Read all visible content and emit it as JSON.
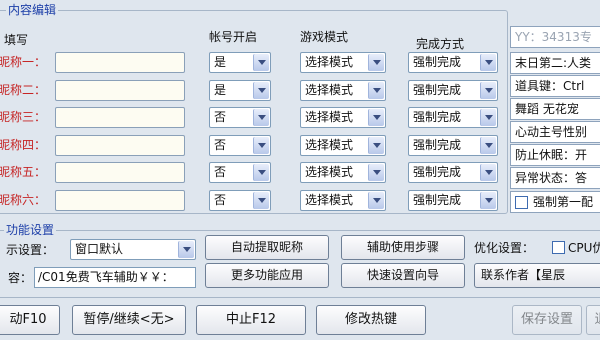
{
  "content_group": {
    "title": "内容编辑",
    "fill_label": "填写",
    "headers": {
      "account_open": "帐号开启",
      "game_mode": "游戏模式",
      "completion": "完成方式"
    },
    "rows": [
      {
        "label": "昵称一：",
        "account": "是",
        "mode": "选择模式",
        "completion": "强制完成"
      },
      {
        "label": "昵称二：",
        "account": "是",
        "mode": "选择模式",
        "completion": "强制完成"
      },
      {
        "label": "昵称三：",
        "account": "否",
        "mode": "选择模式",
        "completion": "强制完成"
      },
      {
        "label": "昵称四：",
        "account": "否",
        "mode": "选择模式",
        "completion": "强制完成"
      },
      {
        "label": "昵称五：",
        "account": "否",
        "mode": "选择模式",
        "completion": "强制完成"
      },
      {
        "label": "昵称六：",
        "account": "否",
        "mode": "选择模式",
        "completion": "强制完成"
      }
    ]
  },
  "right_panel": {
    "yy": "YY：34313专",
    "items": [
      "末日第二:人类",
      "道具键：Ctrl",
      "舞蹈 无花宠",
      "心动主号性别",
      "防止休眠：开",
      "异常状态：答"
    ],
    "force_first_label": "强制第一配"
  },
  "function_group": {
    "title": "功能设置",
    "display_label": "示设置：",
    "display_value": "窗口默认",
    "content_label": "容：",
    "content_value": "/C01免费飞车辅助￥￥：",
    "buttons": {
      "auto_nickname": "自动提取昵称",
      "usage_steps": "辅助使用步骤",
      "more_apps": "更多功能应用",
      "quick_setup": "快速设置向导",
      "contact_author": "联系作者【星辰"
    },
    "optimize_label": "优化设置：",
    "cpu_label": "CPU优"
  },
  "bottom": {
    "start": "动F10",
    "pause": "暂停/继续<无>",
    "stop": "中止F12",
    "hotkey": "修改热键",
    "save": "保存设置",
    "extra": "退"
  },
  "colors": {
    "background": "#dfe6ee",
    "title_blue": "#1d3fa8",
    "label_red": "#c62424"
  }
}
